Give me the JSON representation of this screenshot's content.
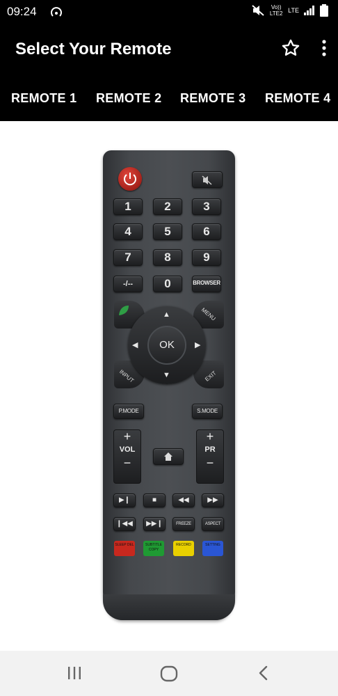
{
  "status_bar": {
    "time": "09:24",
    "volte": "Vo)) LTE2",
    "lte": "LTE"
  },
  "app_bar": {
    "title": "Select Your Remote",
    "favorite_icon": "star-outline-icon",
    "menu_icon": "more-vert-icon"
  },
  "tabs": [
    {
      "label": "REMOTE 1"
    },
    {
      "label": "REMOTE 2"
    },
    {
      "label": "REMOTE 3"
    },
    {
      "label": "REMOTE 4"
    }
  ],
  "remote": {
    "numbers": [
      "1",
      "2",
      "3",
      "4",
      "5",
      "6",
      "7",
      "8",
      "9"
    ],
    "dash_label": "-/--",
    "zero": "0",
    "browser": "BROWSER",
    "menu": "MENU",
    "ok": "OK",
    "input": "INPUT",
    "exit": "EXIT",
    "pmode": "P.MODE",
    "smode": "S.MODE",
    "vol": "VOL",
    "pr": "PR",
    "plus": "+",
    "minus": "−",
    "freeze": "FREEZE",
    "aspect": "ASPECT",
    "color_buttons": [
      {
        "label": "SLEEP DEL",
        "color": "#c8281e"
      },
      {
        "label": "SUBTITLE COPY",
        "color": "#1f9a33"
      },
      {
        "label": "RECORD",
        "color": "#e9d000"
      },
      {
        "label": "SETTING",
        "color": "#2a56d4"
      }
    ]
  },
  "colors": {
    "accent_bar": "#000000",
    "remote_body": "#45484c"
  }
}
